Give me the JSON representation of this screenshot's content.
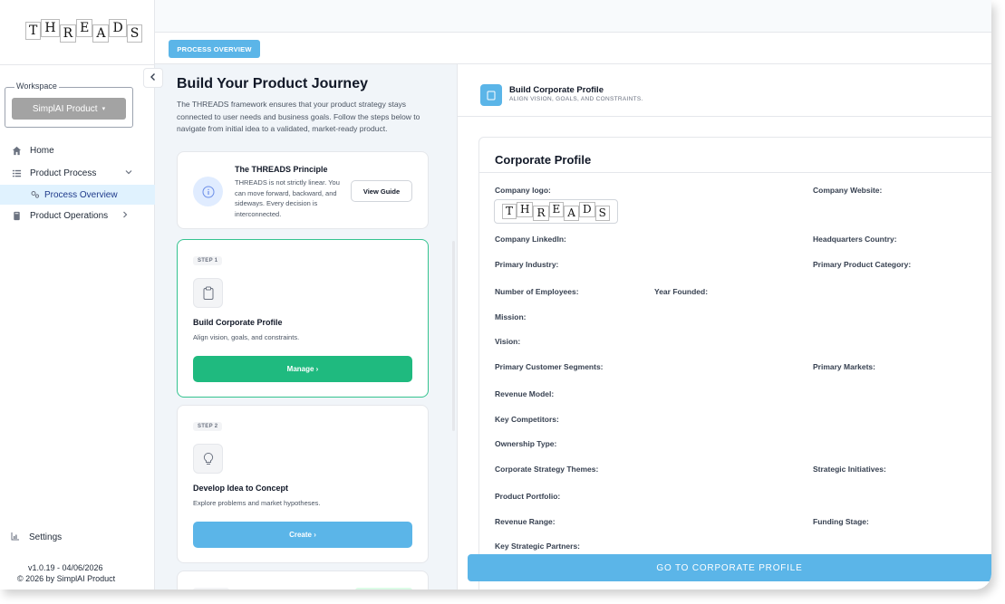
{
  "app": {
    "logo_letters": [
      "T",
      "H",
      "R",
      "E",
      "A",
      "D",
      "S"
    ]
  },
  "sidebar": {
    "workspace_label": "Workspace",
    "workspace_value": "SimplAI Product",
    "items": [
      {
        "label": "Home",
        "icon": "home-icon"
      },
      {
        "label": "Product Process",
        "icon": "list-icon"
      },
      {
        "label": "Process Overview",
        "icon": "process-icon"
      },
      {
        "label": "Product Operations",
        "icon": "book-icon"
      }
    ],
    "settings_label": "Settings",
    "version": "v1.0.19 - 04/06/2026",
    "copyright": "© 2026 by SimplAI Product"
  },
  "tab": {
    "label": "PROCESS OVERVIEW"
  },
  "journey": {
    "title": "Build Your Product Journey",
    "description": "The THREADS framework ensures that your product strategy stays connected to user needs and business goals. Follow the steps below to navigate from initial idea to a validated, market-ready product.",
    "principle": {
      "title": "The THREADS Principle",
      "text": "THREADS is not strictly linear. You can move forward, backward, and sideways. Every decision is interconnected.",
      "button": "View Guide"
    },
    "steps": [
      {
        "badge": "STEP 1",
        "title": "Build Corporate Profile",
        "description": "Align vision, goals, and constraints.",
        "button": "Manage ›",
        "icon": "clipboard-icon"
      },
      {
        "badge": "STEP 2",
        "title": "Develop Idea to Concept",
        "description": "Explore problems and market hypotheses.",
        "button": "Create ›",
        "icon": "lightbulb-icon"
      }
    ]
  },
  "profile": {
    "header_title": "Build Corporate Profile",
    "header_sub": "ALIGN VISION, GOALS, AND CONSTRAINTS.",
    "card_title": "Corporate Profile",
    "fields": {
      "company_logo": "Company logo:",
      "company_website": "Company Website:",
      "company_linkedin": "Company LinkedIn:",
      "hq_country": "Headquarters Country:",
      "primary_industry": "Primary Industry:",
      "primary_product_category": "Primary Product Category:",
      "num_employees": "Number of Employees:",
      "year_founded": "Year Founded:",
      "mission": "Mission:",
      "vision": "Vision:",
      "customer_segments": "Primary Customer Segments:",
      "primary_markets": "Primary Markets:",
      "revenue_model": "Revenue Model:",
      "key_competitors": "Key Competitors:",
      "ownership_type": "Ownership Type:",
      "strategy_themes": "Corporate Strategy Themes:",
      "strategic_initiatives": "Strategic Initiatives:",
      "product_portfolio": "Product Portfolio:",
      "revenue_range": "Revenue Range:",
      "funding_stage": "Funding Stage:",
      "strategic_partners": "Key Strategic Partners:"
    },
    "goto_button": "GO TO CORPORATE PROFILE"
  },
  "colors": {
    "accent_blue": "#5bb5e8",
    "accent_green": "#1fba7f"
  }
}
